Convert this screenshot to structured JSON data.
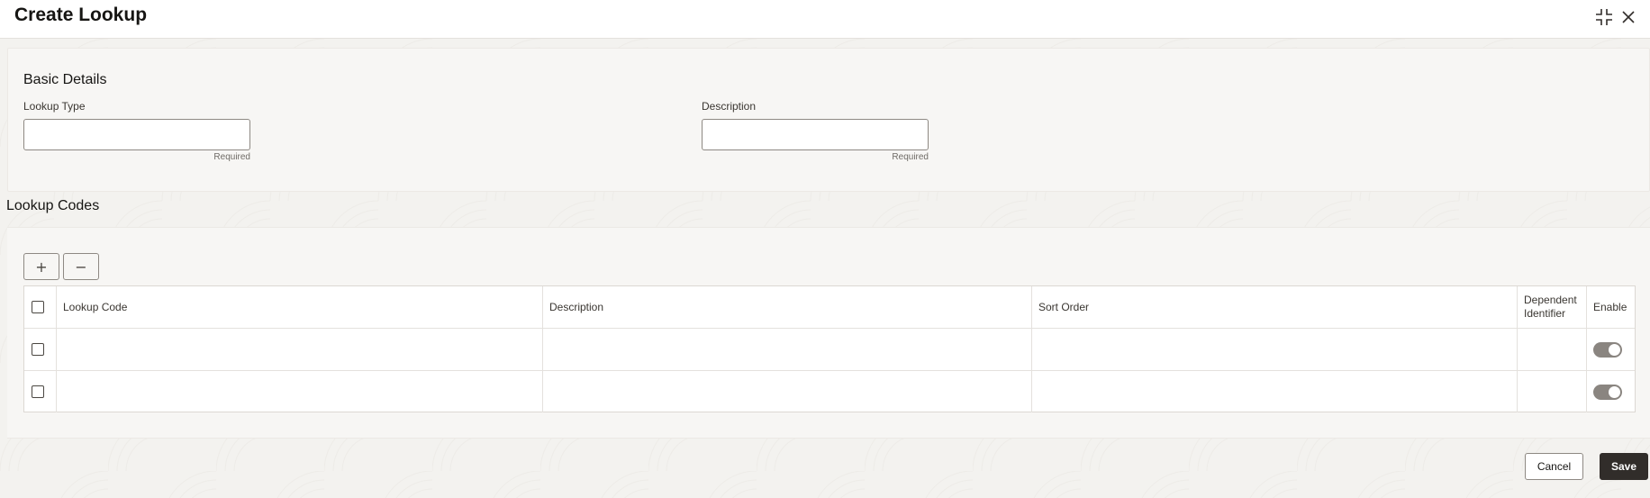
{
  "header": {
    "title": "Create Lookup",
    "icons": [
      "minimize-icon",
      "close-icon"
    ]
  },
  "basic_details": {
    "title": "Basic Details",
    "lookup_type": {
      "label": "Lookup Type",
      "value": "",
      "hint": "Required"
    },
    "description": {
      "label": "Description",
      "value": "",
      "hint": "Required"
    }
  },
  "lookup_codes": {
    "title": "Lookup Codes",
    "toolbar": {
      "add_symbol": "+",
      "remove_symbol": "−"
    },
    "columns": [
      "Lookup Code",
      "Description",
      "Sort Order",
      "Dependent Identifier",
      "Enable"
    ],
    "rows": [
      {
        "lookup_code": "",
        "description": "",
        "sort_order": "",
        "dependent_identifier": "",
        "enable": true
      },
      {
        "lookup_code": "",
        "description": "",
        "sort_order": "",
        "dependent_identifier": "",
        "enable": true
      }
    ]
  },
  "footer": {
    "cancel_label": "Cancel",
    "save_label": "Save"
  },
  "colors": {
    "primary_button": "#312d2a",
    "background": "#f6f5f3",
    "toggle": "#8a8580"
  }
}
